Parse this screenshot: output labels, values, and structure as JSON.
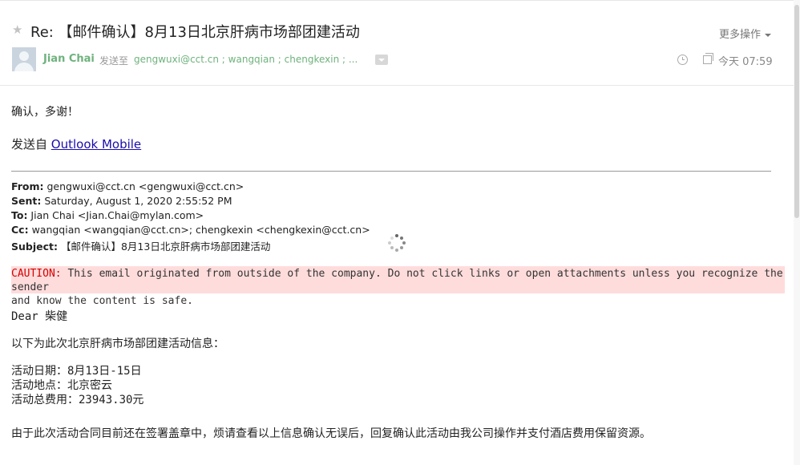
{
  "header": {
    "subject": "Re: 【邮件确认】8月13日北京肝病市场部团建活动",
    "more_ops": "更多操作",
    "sender_name": "Jian Chai",
    "sent_to_label": "发送至",
    "recipients": "gengwuxi@cct.cn ; wangqian ; chengkexin ; ...",
    "time": "今天 07:59"
  },
  "body": {
    "greeting_reply": "确认，多谢！",
    "sent_from_label": "发送自 ",
    "sent_from_link": "Outlook Mobile",
    "forward_meta": [
      {
        "label": "From:",
        "value": " gengwuxi@cct.cn <gengwuxi@cct.cn>"
      },
      {
        "label": "Sent:",
        "value": " Saturday, August 1, 2020 2:55:52 PM"
      },
      {
        "label": "To:",
        "value": " Jian Chai <Jian.Chai@mylan.com>"
      },
      {
        "label": "Cc:",
        "value": " wangqian <wangqian@cct.cn>; chengkexin <chengkexin@cct.cn>"
      },
      {
        "label": "Subject:",
        "value": " 【邮件确认】8月13日北京肝病市场部团建活动"
      }
    ],
    "caution_label": "CAUTION:",
    "caution_text": " This email originated from outside of the company. Do not click links or open attachments unless you recognize the sender",
    "caution_text_2": "and know the content is safe.",
    "dear": "Dear 柴健",
    "intro": "以下为此次北京肝病市场部团建活动信息：",
    "date_line": "活动日期：8月13日-15日",
    "place_line": "活动地点：北京密云",
    "cost_line": "活动总费用：23943.30元",
    "closing": "由于此次活动合同目前还在签署盖章中，烦请查看以上信息确认无误后，回复确认此活动由我公司操作并支付酒店费用保留资源。"
  },
  "colors": {
    "sender_green": "#6fb27d",
    "caution_bg": "#ffdcdc",
    "caution_red": "#d30000",
    "link_blue": "#1a0dab"
  }
}
